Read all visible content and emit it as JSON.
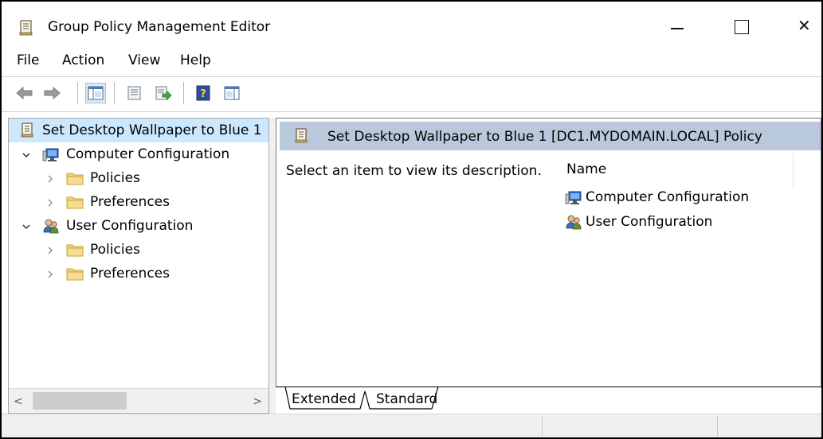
{
  "window": {
    "title": "Group Policy Management Editor",
    "icons": {
      "app": "policy-document-icon",
      "minimize": "minimize-icon",
      "maximize": "maximize-icon",
      "close": "close-icon"
    },
    "close_glyph": "✕"
  },
  "menu": {
    "items": [
      "File",
      "Action",
      "View",
      "Help"
    ]
  },
  "toolbar": {
    "icons": [
      "back-arrow-icon",
      "forward-arrow-icon",
      "show-hide-console-tree-icon",
      "properties-icon",
      "export-list-icon",
      "help-icon",
      "show-hide-action-pane-icon"
    ]
  },
  "tree": {
    "root": {
      "label": "Set Desktop Wallpaper to Blue 1",
      "icon": "policy-document-icon"
    },
    "nodes": [
      {
        "label": "Computer Configuration",
        "icon": "computer-config-icon",
        "expander": "expanded"
      },
      {
        "label": "Policies",
        "icon": "folder-icon",
        "expander": "collapsed"
      },
      {
        "label": "Preferences",
        "icon": "folder-icon",
        "expander": "collapsed"
      },
      {
        "label": "User Configuration",
        "icon": "user-config-icon",
        "expander": "expanded"
      },
      {
        "label": "Policies",
        "icon": "folder-icon",
        "expander": "collapsed"
      },
      {
        "label": "Preferences",
        "icon": "folder-icon",
        "expander": "collapsed"
      }
    ]
  },
  "scrollbar": {
    "left_arrow": "<",
    "right_arrow": ">"
  },
  "details": {
    "header": "Set Desktop Wallpaper to Blue 1 [DC1.MYDOMAIN.LOCAL] Policy",
    "description": "Select an item to view its description.",
    "column_header": "Name",
    "items": [
      {
        "label": "Computer Configuration",
        "icon": "computer-config-icon"
      },
      {
        "label": "User Configuration",
        "icon": "user-config-icon"
      }
    ]
  },
  "tabs": {
    "items": [
      "Extended",
      "Standard"
    ],
    "active": "Extended"
  },
  "colors": {
    "selection": "#cce8ff",
    "header_band": "#b9c9db",
    "folder": "#f2d37b"
  }
}
